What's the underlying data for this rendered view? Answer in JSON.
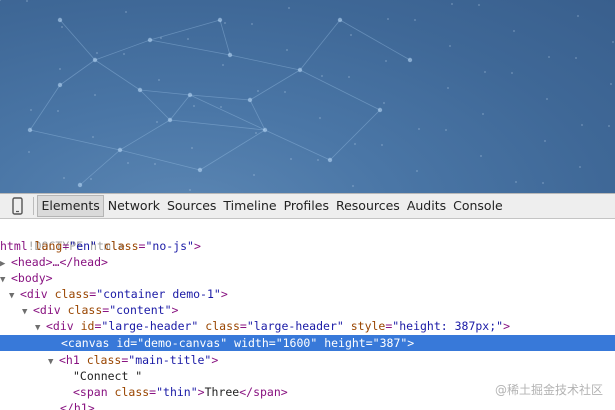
{
  "devtools": {
    "tabs": [
      "Elements",
      "Network",
      "Sources",
      "Timeline",
      "Profiles",
      "Resources",
      "Audits",
      "Console"
    ],
    "active_tab": "Elements"
  },
  "dom_tree": {
    "doctype": "!DOCTYPE html>",
    "html_open": {
      "tag_start": "html ",
      "a1": "lang",
      "v1": "\"en\"",
      "a2": "class",
      "v2": "\"no-js\"",
      "end": ">"
    },
    "head": {
      "text": "<head>…</head>"
    },
    "body": {
      "text": "<body>"
    },
    "div_container": {
      "start": "<div ",
      "attr": "class",
      "val": "\"container demo-1\"",
      "end": ">"
    },
    "div_content": {
      "start": "<div ",
      "attr": "class",
      "val": "\"content\"",
      "end": ">"
    },
    "div_large_header": {
      "start": "<div ",
      "a1": "id",
      "v1": "\"large-header\"",
      "a2": "class",
      "v2": "\"large-header\"",
      "a3": "style",
      "v3": "\"height: 387px;\"",
      "end": ">"
    },
    "canvas": {
      "start": "<canvas ",
      "a1": "id",
      "v1": "\"demo-canvas\"",
      "a2": "width",
      "v2": "\"1600\"",
      "a3": "height",
      "v3": "\"387\"",
      "end": ">"
    },
    "h1": {
      "start": "<h1 ",
      "attr": "class",
      "val": "\"main-title\"",
      "end": ">"
    },
    "text_connect": "\"Connect \"",
    "span": {
      "start": "<span ",
      "attr": "class",
      "val": "\"thin\"",
      "close_start": ">",
      "text": "Three",
      "close": "</span>"
    },
    "h1_close": "</h1>"
  },
  "watermark": "@稀土掘金技术社区",
  "icons": {
    "device": "mobile-device-icon",
    "expand": "triangle-down-icon",
    "collapsed": "triangle-right-icon"
  },
  "colors": {
    "hero": "#3f6897",
    "selection": "#3879d9",
    "tag": "#881280",
    "attr": "#994500",
    "value": "#1a1aa6"
  }
}
